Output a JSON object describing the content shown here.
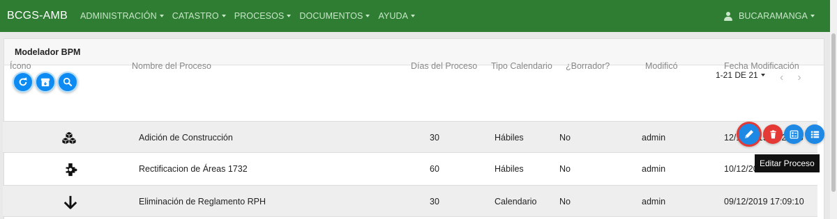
{
  "navbar": {
    "brand": "BCGS-AMB",
    "menu": [
      "ADMINISTRACIÓN",
      "CATASTRO",
      "PROCESOS",
      "DOCUMENTOS",
      "AYUDA"
    ],
    "user": "BUCARAMANGA"
  },
  "card": {
    "title": "Modelador BPM",
    "pager": "1-21 DE 21"
  },
  "table": {
    "headers": [
      "Ícono",
      "Nombre del Proceso",
      "Días del Proceso",
      "Tipo Calendario",
      "¿Borrador?",
      "Modificó",
      "Fecha Modificación"
    ],
    "rows": [
      {
        "icon": "cubes-icon",
        "name": "Adición de Construcción",
        "dias": "30",
        "calendario": "Hábiles",
        "borrador": "No",
        "modifico": "admin",
        "fecha": "12/12/2019 11:29:38"
      },
      {
        "icon": "puzzle-icon",
        "name": "Rectificacion de Áreas 1732",
        "dias": "60",
        "calendario": "Hábiles",
        "borrador": "No",
        "modifico": "admin",
        "fecha": "10/12/2019 10:45:12"
      },
      {
        "icon": "arrow-down-icon",
        "name": "Eliminación de Reglamento RPH",
        "dias": "30",
        "calendario": "Calendario",
        "borrador": "No",
        "modifico": "admin",
        "fecha": "09/12/2019 17:09:10"
      }
    ]
  },
  "tooltip": "Editar Proceso",
  "colors": {
    "navbar": "#2e7d32",
    "primary": "#1e88e5",
    "danger": "#e53935"
  }
}
